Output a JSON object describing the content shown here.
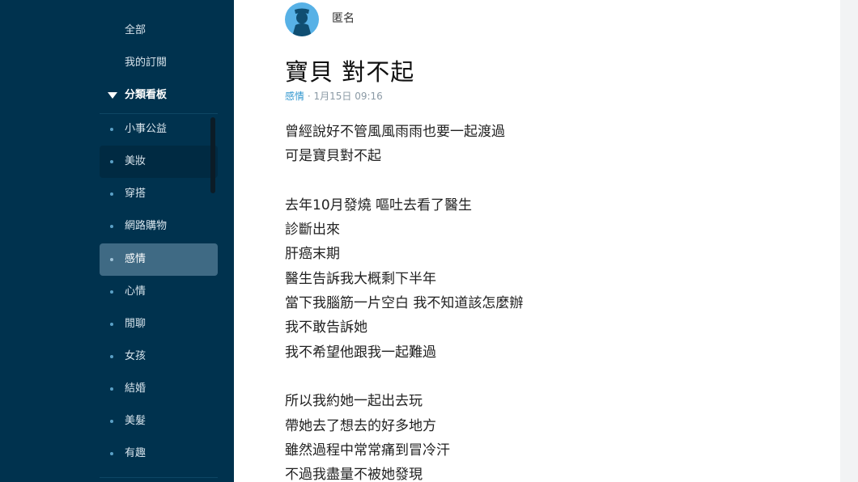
{
  "sidebar": {
    "top_items": [
      {
        "label": "全部"
      },
      {
        "label": "我的訂閱"
      }
    ],
    "section_header": "分類看板",
    "board_items": [
      {
        "label": "小事公益"
      },
      {
        "label": "美妝"
      },
      {
        "label": "穿搭"
      },
      {
        "label": "網路購物"
      },
      {
        "label": "感情"
      },
      {
        "label": "心情"
      },
      {
        "label": "閒聊"
      },
      {
        "label": "女孩"
      },
      {
        "label": "結婚"
      },
      {
        "label": "美髮"
      },
      {
        "label": "有趣"
      }
    ],
    "active_board": "感情",
    "hovered_board": "美妝"
  },
  "post": {
    "author": "匿名",
    "title": "寶貝 對不起",
    "category": "感情",
    "separator": "·",
    "timestamp": "1月15日 09:16",
    "body_lines": [
      "曾經說好不管風風雨雨也要一起渡過",
      "可是寶貝對不起",
      "",
      "去年10月發燒 嘔吐去看了醫生",
      "診斷出來",
      "肝癌末期",
      "醫生告訴我大概剩下半年",
      "當下我腦筋一片空白 我不知道該怎麼辦",
      "我不敢告訴她",
      "我不希望他跟我一起難過",
      "",
      "所以我約她一起出去玩",
      "帶她去了想去的好多地方",
      "雖然過程中常常痛到冒冷汗",
      "不過我盡量不被她發現"
    ]
  },
  "colors": {
    "sidebar_bg": "#00324e",
    "active_item_bg": "#3f6a84",
    "accent_blue": "#3397cf",
    "avatar_bg": "#57b1e6"
  },
  "icons": {
    "avatar": "anonymous-user-icon",
    "section_toggle": "caret-down-icon",
    "bullet": "dot-icon"
  }
}
